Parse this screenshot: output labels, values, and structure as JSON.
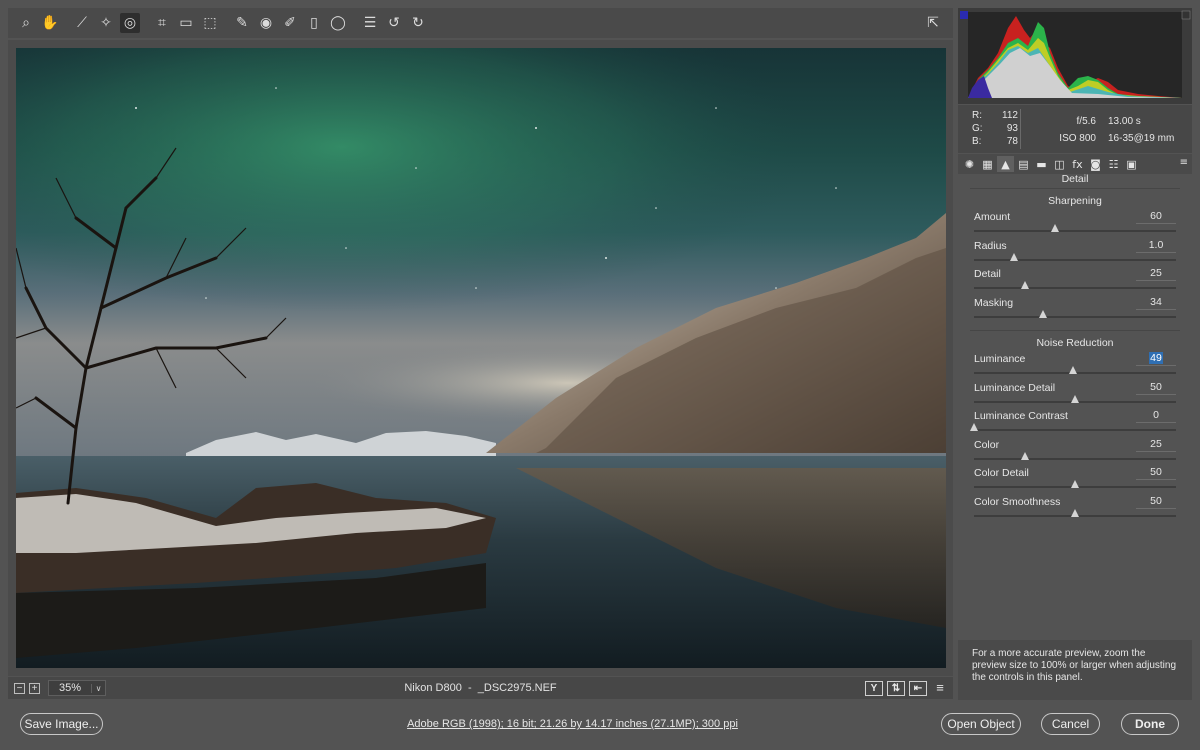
{
  "toolbar": {
    "tools": [
      {
        "name": "zoom-tool",
        "icon": "magnifier-icon",
        "glyph": "⌕"
      },
      {
        "name": "hand-tool",
        "icon": "hand-icon",
        "glyph": "✋"
      },
      {
        "name": "white-balance-tool",
        "icon": "eyedropper-icon",
        "glyph": "⟋"
      },
      {
        "name": "color-sampler-tool",
        "icon": "color-sampler-icon",
        "glyph": "✧"
      },
      {
        "name": "targeted-adjustment-tool",
        "icon": "target-adjust-icon",
        "glyph": "◎"
      },
      {
        "name": "crop-tool",
        "icon": "crop-icon",
        "glyph": "⌗"
      },
      {
        "name": "straighten-tool",
        "icon": "straighten-icon",
        "glyph": "▭"
      },
      {
        "name": "transform-tool",
        "icon": "transform-icon",
        "glyph": "⬚"
      },
      {
        "name": "spot-removal-tool",
        "icon": "brush-heal-icon",
        "glyph": "✎"
      },
      {
        "name": "red-eye-tool",
        "icon": "eye-icon",
        "glyph": "◉"
      },
      {
        "name": "adjustment-brush-tool",
        "icon": "brush-icon",
        "glyph": "✐"
      },
      {
        "name": "graduated-filter-tool",
        "icon": "graduated-filter-icon",
        "glyph": "▯"
      },
      {
        "name": "radial-filter-tool",
        "icon": "radial-filter-icon",
        "glyph": "◯"
      },
      {
        "name": "preferences-tool",
        "icon": "list-icon",
        "glyph": "☰"
      },
      {
        "name": "rotate-left-tool",
        "icon": "rotate-left-icon",
        "glyph": "↺"
      },
      {
        "name": "rotate-right-tool",
        "icon": "rotate-right-icon",
        "glyph": "↻"
      }
    ],
    "fullscreen_icon": "⇱"
  },
  "preview": {
    "zoom": "35%",
    "zoom_minus": "−",
    "zoom_plus": "+",
    "dropdown": "∨",
    "camera": "Nikon D800",
    "separator": "-",
    "file": "_DSC2975.NEF",
    "view_buttons": [
      "Y",
      "⇅",
      "⇤",
      "≡"
    ]
  },
  "readout": {
    "r_label": "R:",
    "r": "112",
    "g_label": "G:",
    "g": "93",
    "b_label": "B:",
    "b": "78",
    "aperture": "f/5.6",
    "shutter": "13.00 s",
    "iso": "ISO 800",
    "lens": "16-35@19 mm"
  },
  "panel_tabs": [
    "✺",
    "▦",
    "▲",
    "▤",
    "▬",
    "◫",
    "fx",
    "◙",
    "☷",
    "▣"
  ],
  "panel_menu": "≡",
  "detail": {
    "title": "Detail",
    "sharpening_title": "Sharpening",
    "noise_title": "Noise Reduction",
    "sharpening": [
      {
        "label": "Amount",
        "value": "60",
        "pos": 0.4
      },
      {
        "label": "Radius",
        "value": "1.0",
        "pos": 0.2
      },
      {
        "label": "Detail",
        "value": "25",
        "pos": 0.25
      },
      {
        "label": "Masking",
        "value": "34",
        "pos": 0.34
      }
    ],
    "noise": [
      {
        "label": "Luminance",
        "value": "49",
        "pos": 0.49,
        "focus": true
      },
      {
        "label": "Luminance Detail",
        "value": "50",
        "pos": 0.5
      },
      {
        "label": "Luminance Contrast",
        "value": "0",
        "pos": 0.0
      },
      {
        "label": "Color",
        "value": "25",
        "pos": 0.25
      },
      {
        "label": "Color Detail",
        "value": "50",
        "pos": 0.5
      },
      {
        "label": "Color Smoothness",
        "value": "50",
        "pos": 0.5
      }
    ],
    "hint": "For a more accurate preview, zoom the preview size to 100% or larger when adjusting the controls in this panel."
  },
  "footer": {
    "save": "Save Image...",
    "workflow": "Adobe RGB (1998); 16 bit; 21.26 by 14.17 inches (27.1MP); 300 ppi",
    "open": "Open Object",
    "cancel": "Cancel",
    "done": "Done"
  },
  "colors": {
    "sky_top": "#1f3a3c",
    "aurora": "#2f8a6a",
    "mountain_snow": "#c9c0b4",
    "water": "#1e2c33",
    "highlight": "#2f6fb3"
  }
}
